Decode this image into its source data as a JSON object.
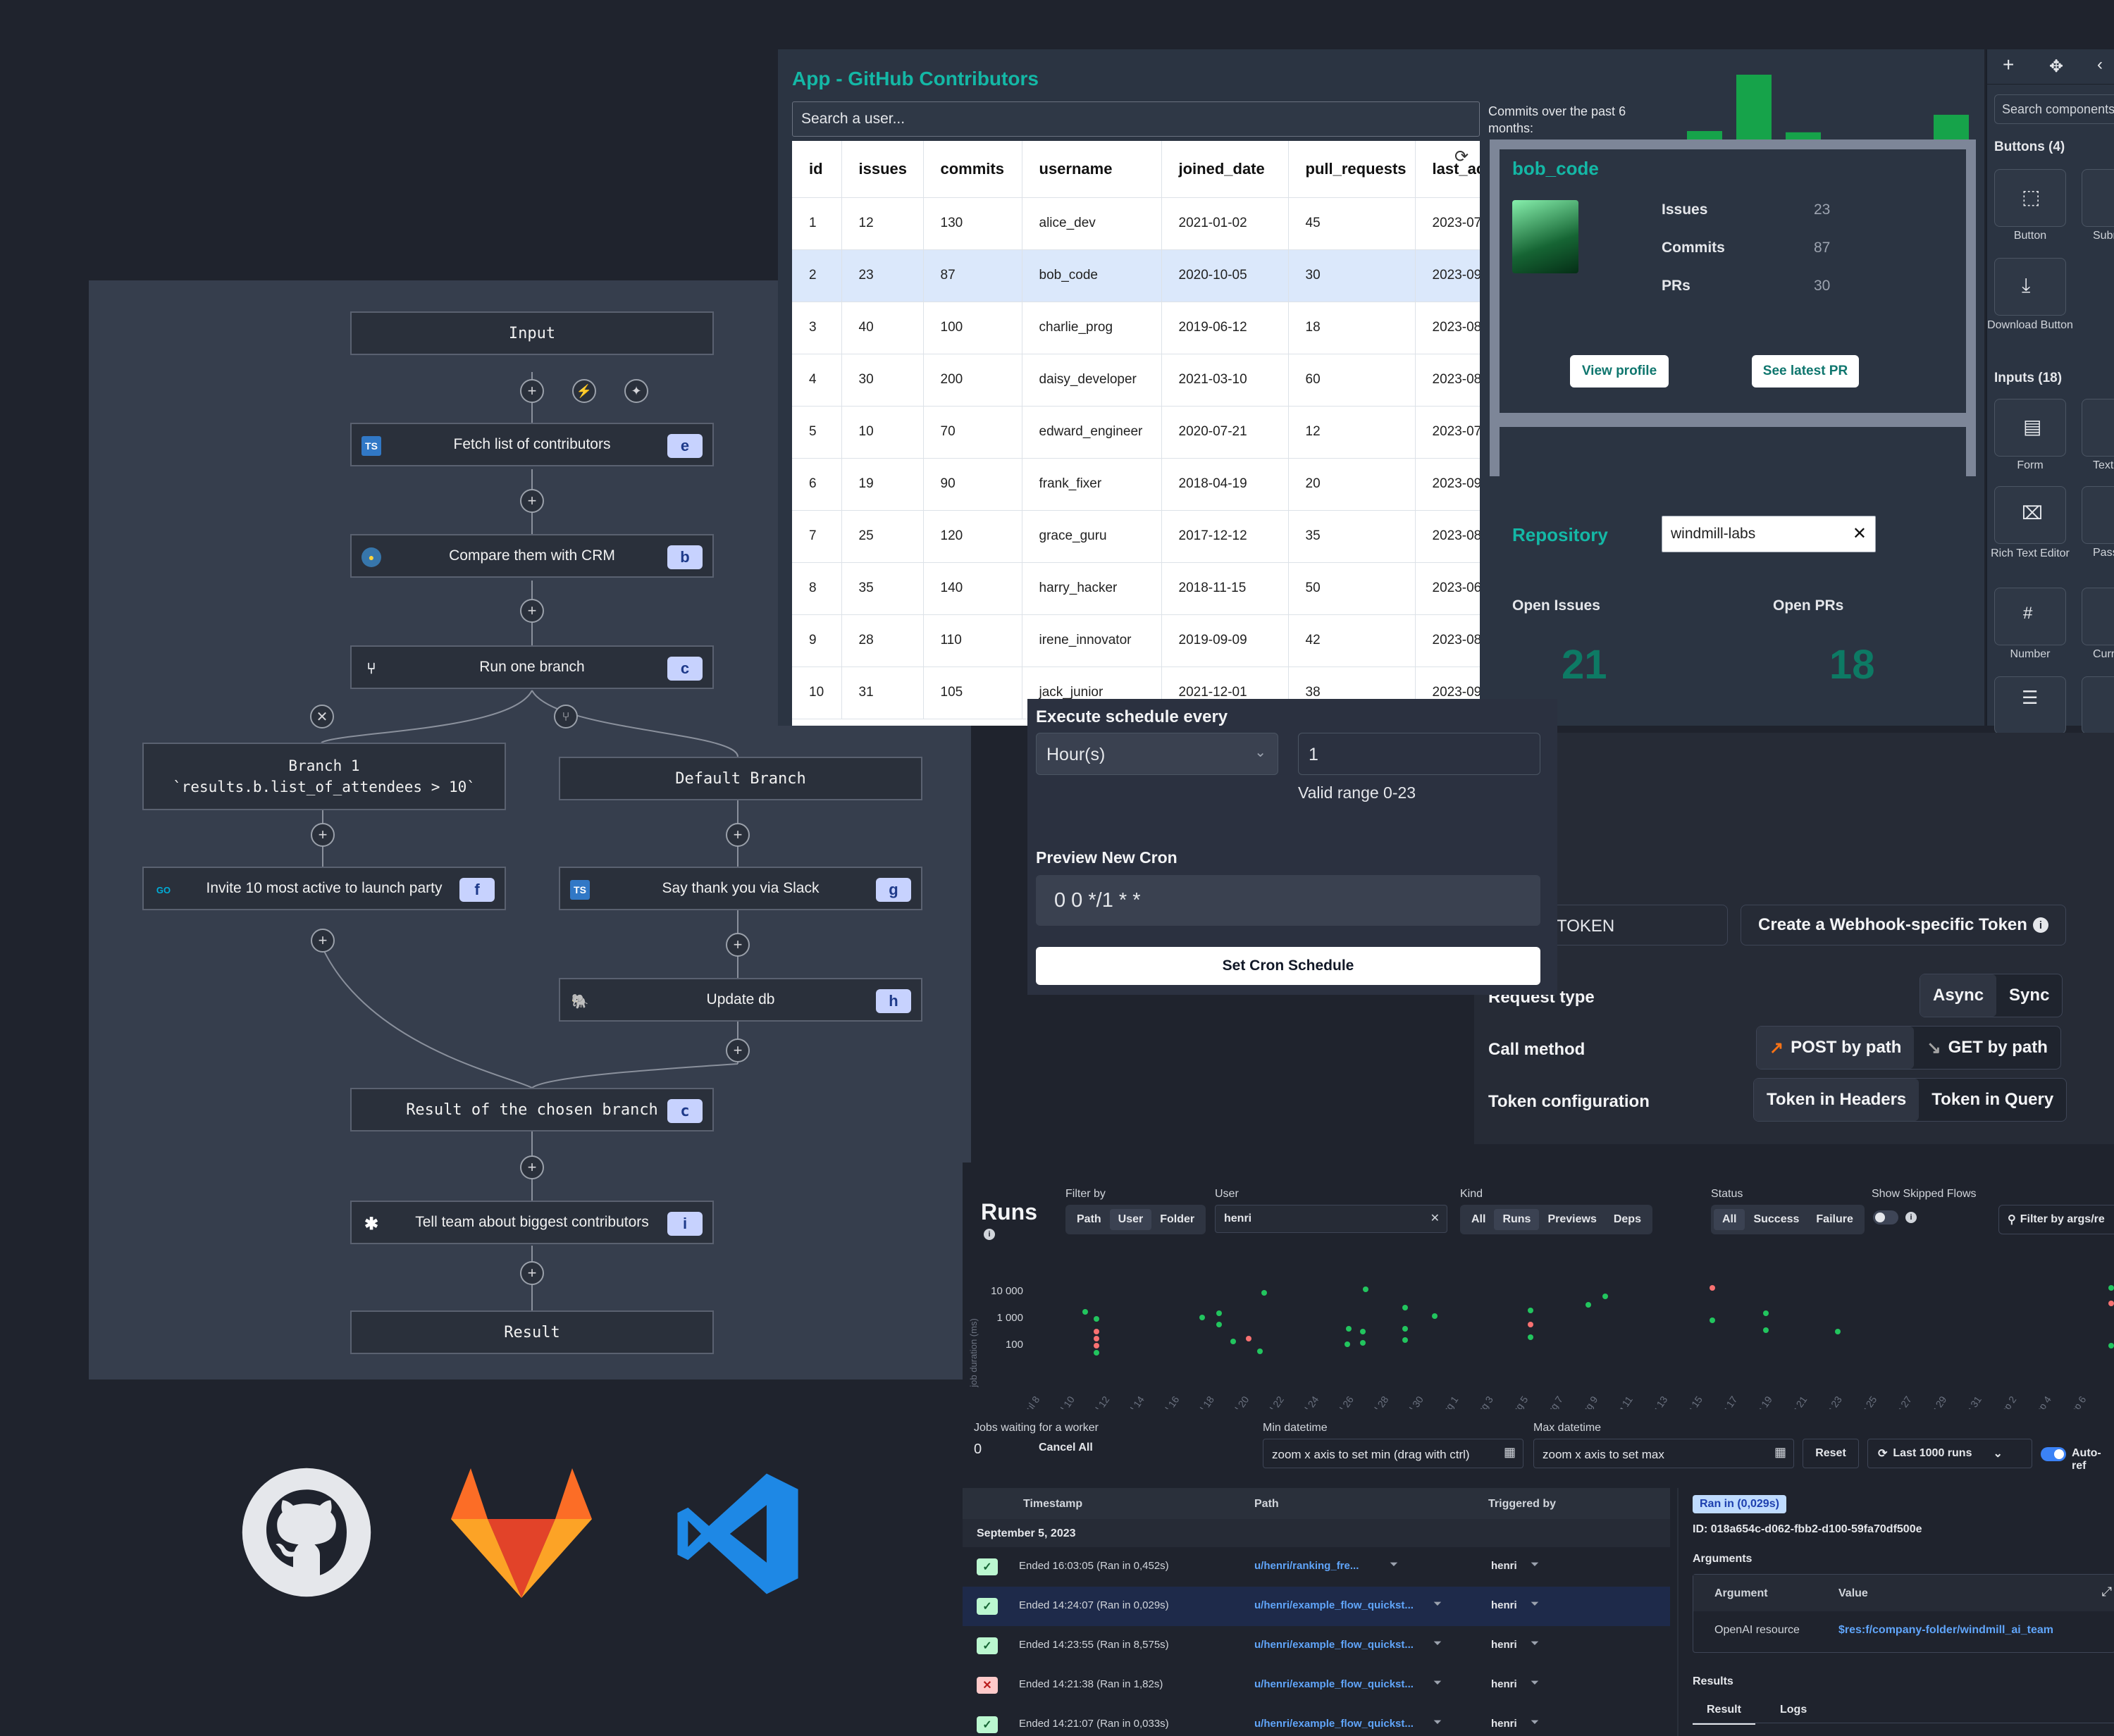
{
  "flow": {
    "input": "Input",
    "fetch": {
      "label": "Fetch list of contributors",
      "icon": "TS",
      "letter": "e"
    },
    "compare": {
      "label": "Compare them with CRM",
      "letter": "b"
    },
    "branch": {
      "label": "Run one branch",
      "letter": "c"
    },
    "branch1": {
      "title": "Branch 1",
      "expr": "`results.b.list_of_attendees > 10`"
    },
    "default_branch": "Default Branch",
    "invite": {
      "label": "Invite 10 most active to launch party",
      "icon": "GO",
      "letter": "f"
    },
    "slack_thanks": {
      "label": "Say thank you via Slack",
      "icon": "TS",
      "letter": "g"
    },
    "update_db": {
      "label": "Update db",
      "letter": "h"
    },
    "result_branch": {
      "label": "Result of the chosen branch",
      "letter": "c"
    },
    "tell_team": {
      "label": "Tell team about biggest contributors",
      "letter": "i"
    },
    "result": "Result"
  },
  "app": {
    "title": "App - GitHub Contributors",
    "search_placeholder": "Search a user...",
    "chart_label": "Commits over the past 6 months:",
    "columns": [
      "id",
      "issues",
      "commits",
      "username",
      "joined_date",
      "pull_requests",
      "last_ac"
    ],
    "rows": [
      [
        "1",
        "12",
        "130",
        "alice_dev",
        "2021-01-02",
        "45",
        "2023-07"
      ],
      [
        "2",
        "23",
        "87",
        "bob_code",
        "2020-10-05",
        "30",
        "2023-09"
      ],
      [
        "3",
        "40",
        "100",
        "charlie_prog",
        "2019-06-12",
        "18",
        "2023-08"
      ],
      [
        "4",
        "30",
        "200",
        "daisy_developer",
        "2021-03-10",
        "60",
        "2023-08"
      ],
      [
        "5",
        "10",
        "70",
        "edward_engineer",
        "2020-07-21",
        "12",
        "2023-07"
      ],
      [
        "6",
        "19",
        "90",
        "frank_fixer",
        "2018-04-19",
        "20",
        "2023-09"
      ],
      [
        "7",
        "25",
        "120",
        "grace_guru",
        "2017-12-12",
        "35",
        "2023-08"
      ],
      [
        "8",
        "35",
        "140",
        "harry_hacker",
        "2018-11-15",
        "50",
        "2023-06"
      ],
      [
        "9",
        "28",
        "110",
        "irene_innovator",
        "2019-09-09",
        "42",
        "2023-08"
      ],
      [
        "10",
        "31",
        "105",
        "jack_junior",
        "2021-12-01",
        "38",
        "2023-09"
      ]
    ],
    "user_card": {
      "name": "bob_code",
      "issues_label": "Issues",
      "issues": "23",
      "commits_label": "Commits",
      "commits": "87",
      "prs_label": "PRs",
      "prs": "30",
      "view_profile": "View profile",
      "latest_pr": "See latest PR"
    },
    "repo": {
      "label": "Repository",
      "value": "windmill-labs",
      "open_issues_label": "Open Issues",
      "open_issues": "21",
      "open_prs_label": "Open PRs",
      "open_prs": "18"
    }
  },
  "chart_data": {
    "type": "bar",
    "title": "Commits over the past 6 months:",
    "categories": [
      "",
      "",
      "",
      "",
      "",
      "",
      ""
    ],
    "values": [
      45,
      90,
      44,
      20,
      35,
      58
    ],
    "color": "#16a34a"
  },
  "side": {
    "search_placeholder": "Search components",
    "buttons_heading": "Buttons (4)",
    "inputs_heading": "Inputs (18)",
    "items": [
      "Button",
      "Subm",
      "Download Button",
      "Form",
      "Text",
      "Rich Text Editor",
      "Pass",
      "Number",
      "Curr"
    ]
  },
  "cron": {
    "title": "Execute schedule every",
    "unit": "Hour(s)",
    "value": "1",
    "hint": "Valid range 0-23",
    "preview_label": "Preview New Cron",
    "preview": "0 0 */1 * *",
    "button": "Set Cron Schedule"
  },
  "webhook": {
    "token_label": "TOKEN",
    "create_token": "Create a Webhook-specific Token",
    "request_type": "Request type",
    "async": "Async",
    "sync": "Sync",
    "call_method": "Call method",
    "post": "POST by path",
    "get": "GET by path",
    "token_config": "Token configuration",
    "in_headers": "Token in Headers",
    "in_query": "Token in Query"
  },
  "runs": {
    "title": "Runs",
    "filter_by": "Filter by",
    "filter_opts": [
      "Path",
      "User",
      "Folder"
    ],
    "user_label": "User",
    "user_value": "henri",
    "kind_label": "Kind",
    "kind_opts": [
      "All",
      "Runs",
      "Previews",
      "Deps"
    ],
    "status_label": "Status",
    "status_opts": [
      "All",
      "Success",
      "Failure"
    ],
    "skipped_label": "Show Skipped Flows",
    "filter_args": "Filter by args/re",
    "y_axis_label": "job duration (ms)",
    "y_ticks": [
      "10 000",
      "1 000",
      "100"
    ],
    "x_ticks": [
      "Jul 8",
      "Jul 10",
      "Jul 12",
      "Jul 14",
      "Jul 16",
      "Jul 18",
      "Jul 20",
      "Jul 22",
      "Jul 24",
      "Jul 26",
      "Jul 28",
      "Jul 30",
      "Aug 1",
      "Aug 3",
      "Aug 5",
      "Aug 7",
      "Aug 9",
      "Aug 11",
      "Aug 13",
      "Aug 15",
      "Aug 17",
      "Aug 19",
      "Aug 21",
      "Aug 23",
      "Aug 25",
      "Aug 27",
      "Aug 29",
      "Aug 31",
      "Sep 2",
      "Sep 4",
      "Sep 6"
    ],
    "jobs_waiting_label": "Jobs waiting for a worker",
    "jobs_waiting": "0",
    "cancel_all": "Cancel All",
    "min_dt_label": "Min datetime",
    "min_dt_placeholder": "zoom x axis to set min (drag with ctrl)",
    "max_dt_label": "Max datetime",
    "max_dt_placeholder": "zoom x axis to set max",
    "reset": "Reset",
    "last_runs": "Last 1000 runs",
    "auto_refresh": "Auto-ref",
    "col_timestamp": "Timestamp",
    "col_path": "Path",
    "col_triggered": "Triggered by",
    "date_group": "September 5, 2023",
    "list": [
      {
        "status": "ok",
        "ts": "Ended 16:03:05 (Ran in 0,452s)",
        "path": "u/henri/ranking_fre...",
        "by": "henri"
      },
      {
        "status": "ok",
        "ts": "Ended 14:24:07 (Ran in 0,029s)",
        "path": "u/henri/example_flow_quickst...",
        "by": "henri"
      },
      {
        "status": "ok",
        "ts": "Ended 14:23:55 (Ran in 8,575s)",
        "path": "u/henri/example_flow_quickst...",
        "by": "henri"
      },
      {
        "status": "fail",
        "ts": "Ended 14:21:38 (Ran in 1,82s)",
        "path": "u/henri/example_flow_quickst...",
        "by": "henri"
      },
      {
        "status": "ok",
        "ts": "Ended 14:21:07 (Ran in 0,033s)",
        "path": "u/henri/example_flow_quickst...",
        "by": "henri"
      }
    ],
    "detail": {
      "badge": "Ran in (0,029s)",
      "id": "ID: 018a654c-d062-fbb2-d100-59fa70df500e",
      "arguments": "Arguments",
      "arg_col": "Argument",
      "val_col": "Value",
      "arg_name": "OpenAI resource",
      "arg_value": "$res:f/company-folder/windmill_ai_team",
      "results": "Results",
      "tab_result": "Result",
      "tab_logs": "Logs"
    }
  }
}
